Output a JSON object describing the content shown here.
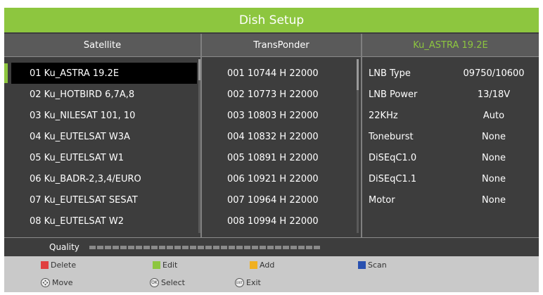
{
  "title": "Dish Setup",
  "headers": {
    "satellite": "Satellite",
    "transponder": "TransPonder",
    "selected_sat": "Ku_ASTRA 19.2E"
  },
  "accent_color": "#8dc63f",
  "satellites": [
    "01 Ku_ASTRA 19.2E",
    "02 Ku_HOTBIRD 6,7A,8",
    "03 Ku_NILESAT 101, 10",
    "04 Ku_EUTELSAT W3A",
    "05 Ku_EUTELSAT W1",
    "06 Ku_BADR-2,3,4/EURO",
    "07 Ku_EUTELSAT SESAT",
    "08 Ku_EUTELSAT W2"
  ],
  "transponders": [
    "001 10744 H 22000",
    "002 10773 H 22000",
    "003 10803 H 22000",
    "004 10832 H 22000",
    "005 10891 H 22000",
    "006 10921 H 22000",
    "007 10964 H 22000",
    "008 10994 H 22000"
  ],
  "settings": [
    {
      "label": "LNB Type",
      "value": "09750/10600"
    },
    {
      "label": "LNB Power",
      "value": "13/18V"
    },
    {
      "label": "22KHz",
      "value": "Auto"
    },
    {
      "label": "Toneburst",
      "value": "None"
    },
    {
      "label": "DiSEqC1.0",
      "value": "None"
    },
    {
      "label": "DiSEqC1.1",
      "value": "None"
    },
    {
      "label": "Motor",
      "value": "None"
    }
  ],
  "quality": {
    "label": "Quality",
    "level": 0
  },
  "footer": {
    "delete": "Delete",
    "edit": "Edit",
    "add": "Add",
    "scan": "Scan",
    "move": "Move",
    "select": "Select",
    "exit": "Exit",
    "colors": {
      "delete": "#e04040",
      "edit": "#8dc63f",
      "add": "#f0b020",
      "scan": "#2850b0"
    },
    "icons": {
      "move": "dpad-icon",
      "select": "ok-icon",
      "exit": "exit-icon"
    },
    "icon_text": {
      "select": "OK",
      "exit": "EXIT"
    }
  }
}
